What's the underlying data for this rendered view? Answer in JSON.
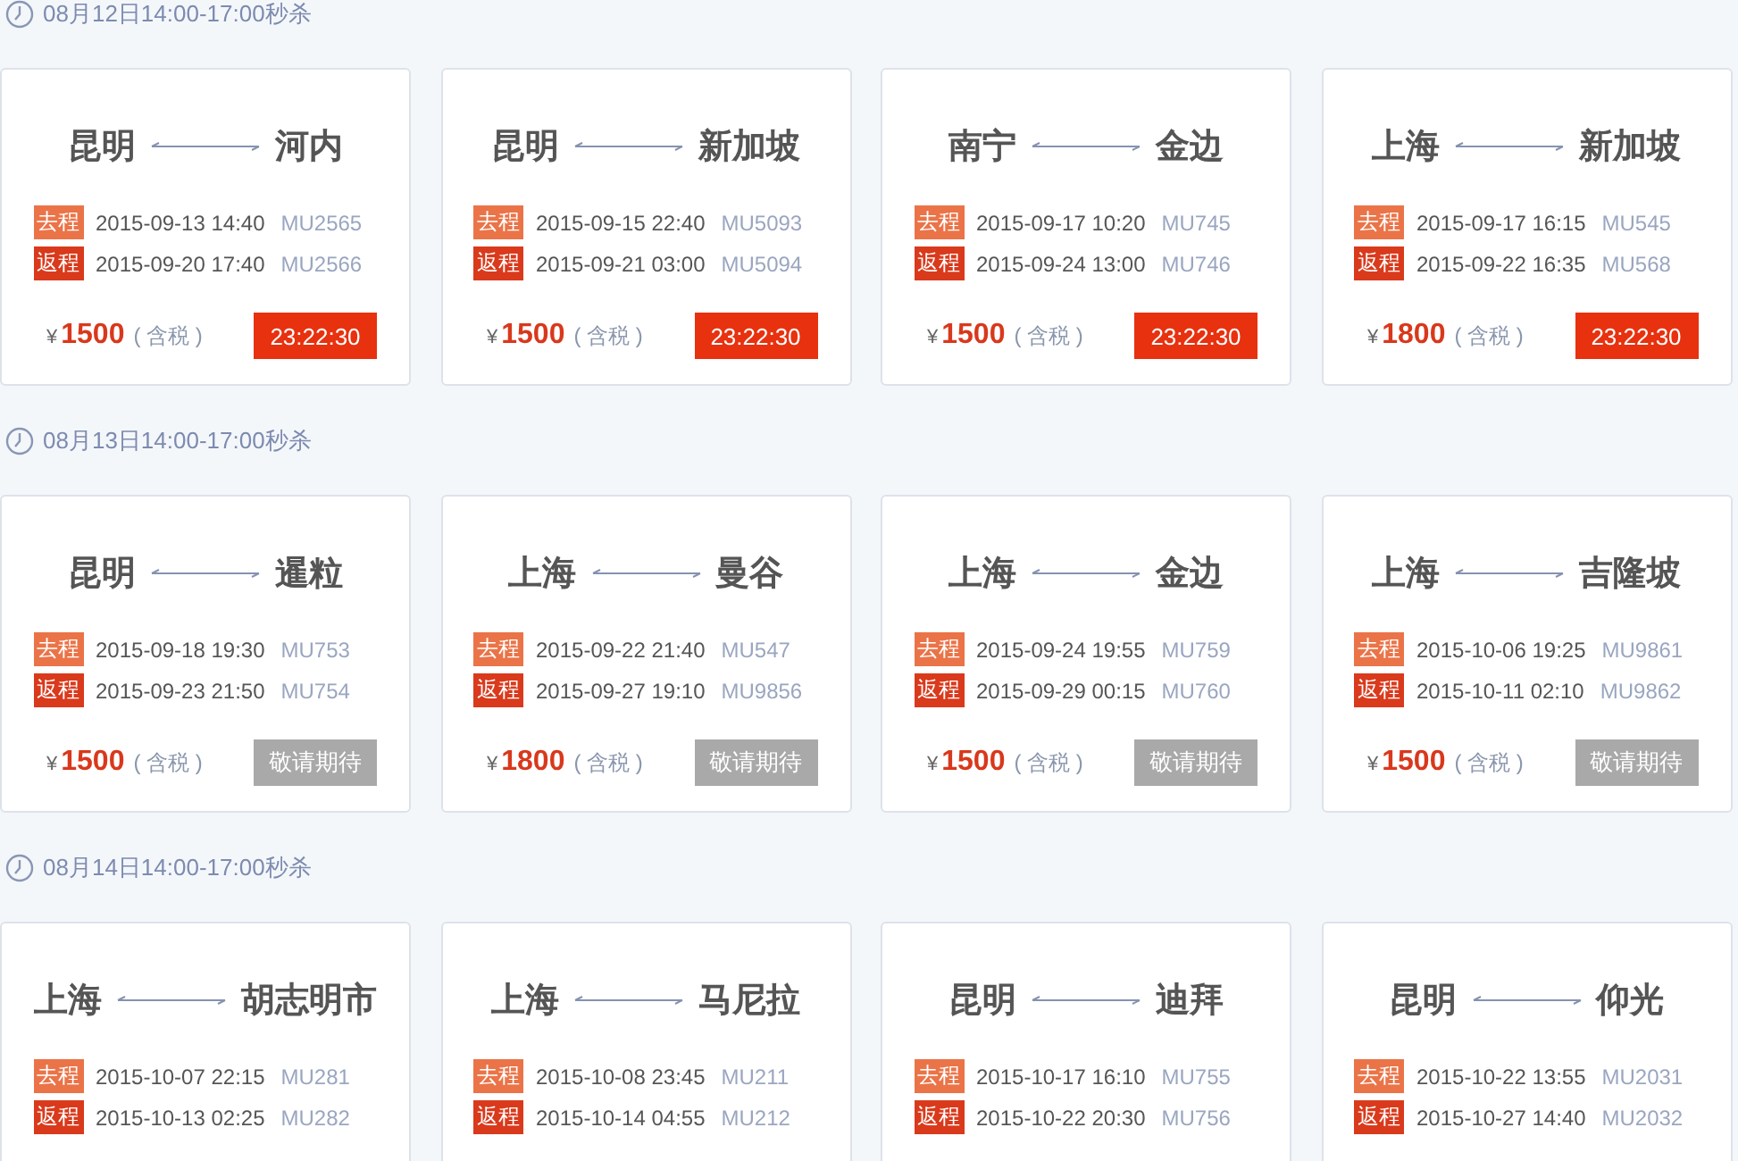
{
  "sections": [
    {
      "title": "08月12日14:00-17:00秒杀",
      "cards": [
        {
          "from": "昆明",
          "to": "河内",
          "legs": [
            {
              "kind": "outbound",
              "tag": "去程",
              "time": "2015-09-13 14:40",
              "flight": "MU2565"
            },
            {
              "kind": "return",
              "tag": "返程",
              "time": "2015-09-20 17:40",
              "flight": "MU2566"
            }
          ],
          "currency": "¥",
          "price": "1500",
          "tax": "( 含税 )",
          "button": {
            "kind": "countdown",
            "label": "23:22:30"
          }
        },
        {
          "from": "昆明",
          "to": "新加坡",
          "legs": [
            {
              "kind": "outbound",
              "tag": "去程",
              "time": "2015-09-15 22:40",
              "flight": "MU5093"
            },
            {
              "kind": "return",
              "tag": "返程",
              "time": "2015-09-21 03:00",
              "flight": "MU5094"
            }
          ],
          "currency": "¥",
          "price": "1500",
          "tax": "( 含税 )",
          "button": {
            "kind": "countdown",
            "label": "23:22:30"
          }
        },
        {
          "from": "南宁",
          "to": "金边",
          "legs": [
            {
              "kind": "outbound",
              "tag": "去程",
              "time": "2015-09-17 10:20",
              "flight": "MU745"
            },
            {
              "kind": "return",
              "tag": "返程",
              "time": "2015-09-24 13:00",
              "flight": "MU746"
            }
          ],
          "currency": "¥",
          "price": "1500",
          "tax": "( 含税 )",
          "button": {
            "kind": "countdown",
            "label": "23:22:30"
          }
        },
        {
          "from": "上海",
          "to": "新加坡",
          "legs": [
            {
              "kind": "outbound",
              "tag": "去程",
              "time": "2015-09-17 16:15",
              "flight": "MU545"
            },
            {
              "kind": "return",
              "tag": "返程",
              "time": "2015-09-22 16:35",
              "flight": "MU568"
            }
          ],
          "currency": "¥",
          "price": "1800",
          "tax": "( 含税 )",
          "button": {
            "kind": "countdown",
            "label": "23:22:30"
          }
        }
      ]
    },
    {
      "title": "08月13日14:00-17:00秒杀",
      "cards": [
        {
          "from": "昆明",
          "to": "暹粒",
          "legs": [
            {
              "kind": "outbound",
              "tag": "去程",
              "time": "2015-09-18 19:30",
              "flight": "MU753"
            },
            {
              "kind": "return",
              "tag": "返程",
              "time": "2015-09-23 21:50",
              "flight": "MU754"
            }
          ],
          "currency": "¥",
          "price": "1500",
          "tax": "( 含税 )",
          "button": {
            "kind": "pending",
            "label": "敬请期待"
          }
        },
        {
          "from": "上海",
          "to": "曼谷",
          "legs": [
            {
              "kind": "outbound",
              "tag": "去程",
              "time": "2015-09-22 21:40",
              "flight": "MU547"
            },
            {
              "kind": "return",
              "tag": "返程",
              "time": "2015-09-27 19:10",
              "flight": "MU9856"
            }
          ],
          "currency": "¥",
          "price": "1800",
          "tax": "( 含税 )",
          "button": {
            "kind": "pending",
            "label": "敬请期待"
          }
        },
        {
          "from": "上海",
          "to": "金边",
          "legs": [
            {
              "kind": "outbound",
              "tag": "去程",
              "time": "2015-09-24 19:55",
              "flight": "MU759"
            },
            {
              "kind": "return",
              "tag": "返程",
              "time": "2015-09-29 00:15",
              "flight": "MU760"
            }
          ],
          "currency": "¥",
          "price": "1500",
          "tax": "( 含税 )",
          "button": {
            "kind": "pending",
            "label": "敬请期待"
          }
        },
        {
          "from": "上海",
          "to": "吉隆坡",
          "legs": [
            {
              "kind": "outbound",
              "tag": "去程",
              "time": "2015-10-06 19:25",
              "flight": "MU9861"
            },
            {
              "kind": "return",
              "tag": "返程",
              "time": "2015-10-11 02:10",
              "flight": "MU9862"
            }
          ],
          "currency": "¥",
          "price": "1500",
          "tax": "( 含税 )",
          "button": {
            "kind": "pending",
            "label": "敬请期待"
          }
        }
      ]
    },
    {
      "title": "08月14日14:00-17:00秒杀",
      "cards": [
        {
          "from": "上海",
          "to": "胡志明市",
          "legs": [
            {
              "kind": "outbound",
              "tag": "去程",
              "time": "2015-10-07 22:15",
              "flight": "MU281"
            },
            {
              "kind": "return",
              "tag": "返程",
              "time": "2015-10-13 02:25",
              "flight": "MU282"
            }
          ]
        },
        {
          "from": "上海",
          "to": "马尼拉",
          "legs": [
            {
              "kind": "outbound",
              "tag": "去程",
              "time": "2015-10-08 23:45",
              "flight": "MU211"
            },
            {
              "kind": "return",
              "tag": "返程",
              "time": "2015-10-14 04:55",
              "flight": "MU212"
            }
          ]
        },
        {
          "from": "昆明",
          "to": "迪拜",
          "legs": [
            {
              "kind": "outbound",
              "tag": "去程",
              "time": "2015-10-17 16:10",
              "flight": "MU755"
            },
            {
              "kind": "return",
              "tag": "返程",
              "time": "2015-10-22 20:30",
              "flight": "MU756"
            }
          ]
        },
        {
          "from": "昆明",
          "to": "仰光",
          "legs": [
            {
              "kind": "outbound",
              "tag": "去程",
              "time": "2015-10-22 13:55",
              "flight": "MU2031"
            },
            {
              "kind": "return",
              "tag": "返程",
              "time": "2015-10-27 14:40",
              "flight": "MU2032"
            }
          ]
        }
      ]
    }
  ]
}
